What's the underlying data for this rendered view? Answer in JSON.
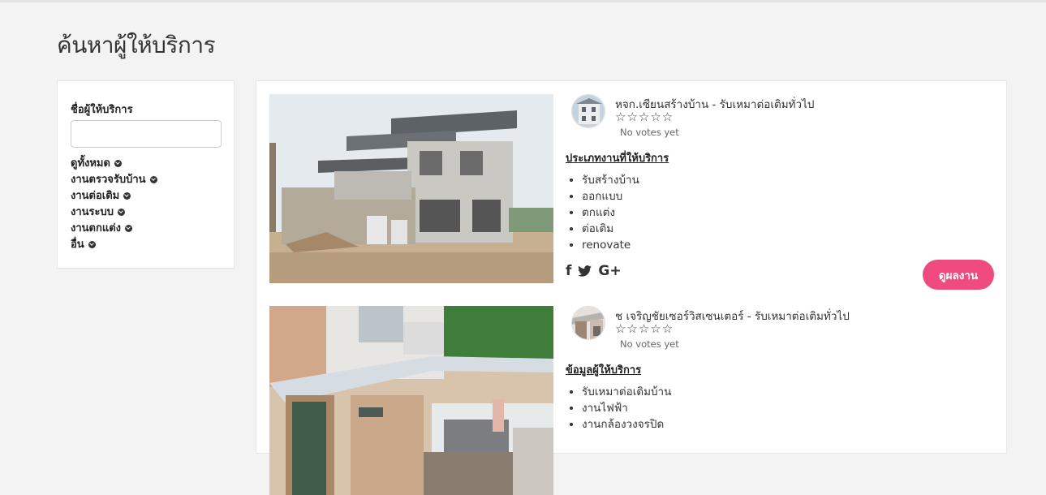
{
  "page": {
    "title": "ค้นหาผู้ให้บริการ"
  },
  "sidebar": {
    "filter_label": "ชื่อผู้ให้บริการ",
    "filter_value": "",
    "categories": [
      {
        "label": "ดูทั้งหมด"
      },
      {
        "label": "งานตรวจรับบ้าน"
      },
      {
        "label": "งานต่อเติม"
      },
      {
        "label": "งานระบบ"
      },
      {
        "label": "งานตกแต่ง"
      },
      {
        "label": "อื่น"
      }
    ]
  },
  "providers": [
    {
      "name": "หจก.เซียนสร้างบ้าน - รับเหมาต่อเติมทั่วไป",
      "stars": "☆☆☆☆☆",
      "votes": "No votes yet",
      "section_title": "ประเภทงานที่ให้บริการ",
      "services": [
        "รับสร้างบ้าน",
        "ออกแบบ",
        "ตกแต่ง",
        "ต่อเติม",
        "renovate"
      ],
      "social": {
        "facebook": "f",
        "twitter": "🐦",
        "googleplus": "G+"
      },
      "button": "ดูผลงาน"
    },
    {
      "name": "ช เจริญชัยเซอร์วิสเซนเตอร์ - รับเหมาต่อเติมทั่วไป",
      "stars": "☆☆☆☆☆",
      "votes": "No votes yet",
      "section_title": "ข้อมูลผู้ให้บริการ",
      "services": [
        "รับเหมาต่อเติมบ้าน",
        "งานไฟฟ้า",
        "งานกล้องวงจรปิด"
      ]
    }
  ],
  "colors": {
    "accent": "#ef4b7e",
    "background": "#f3f3f3"
  }
}
